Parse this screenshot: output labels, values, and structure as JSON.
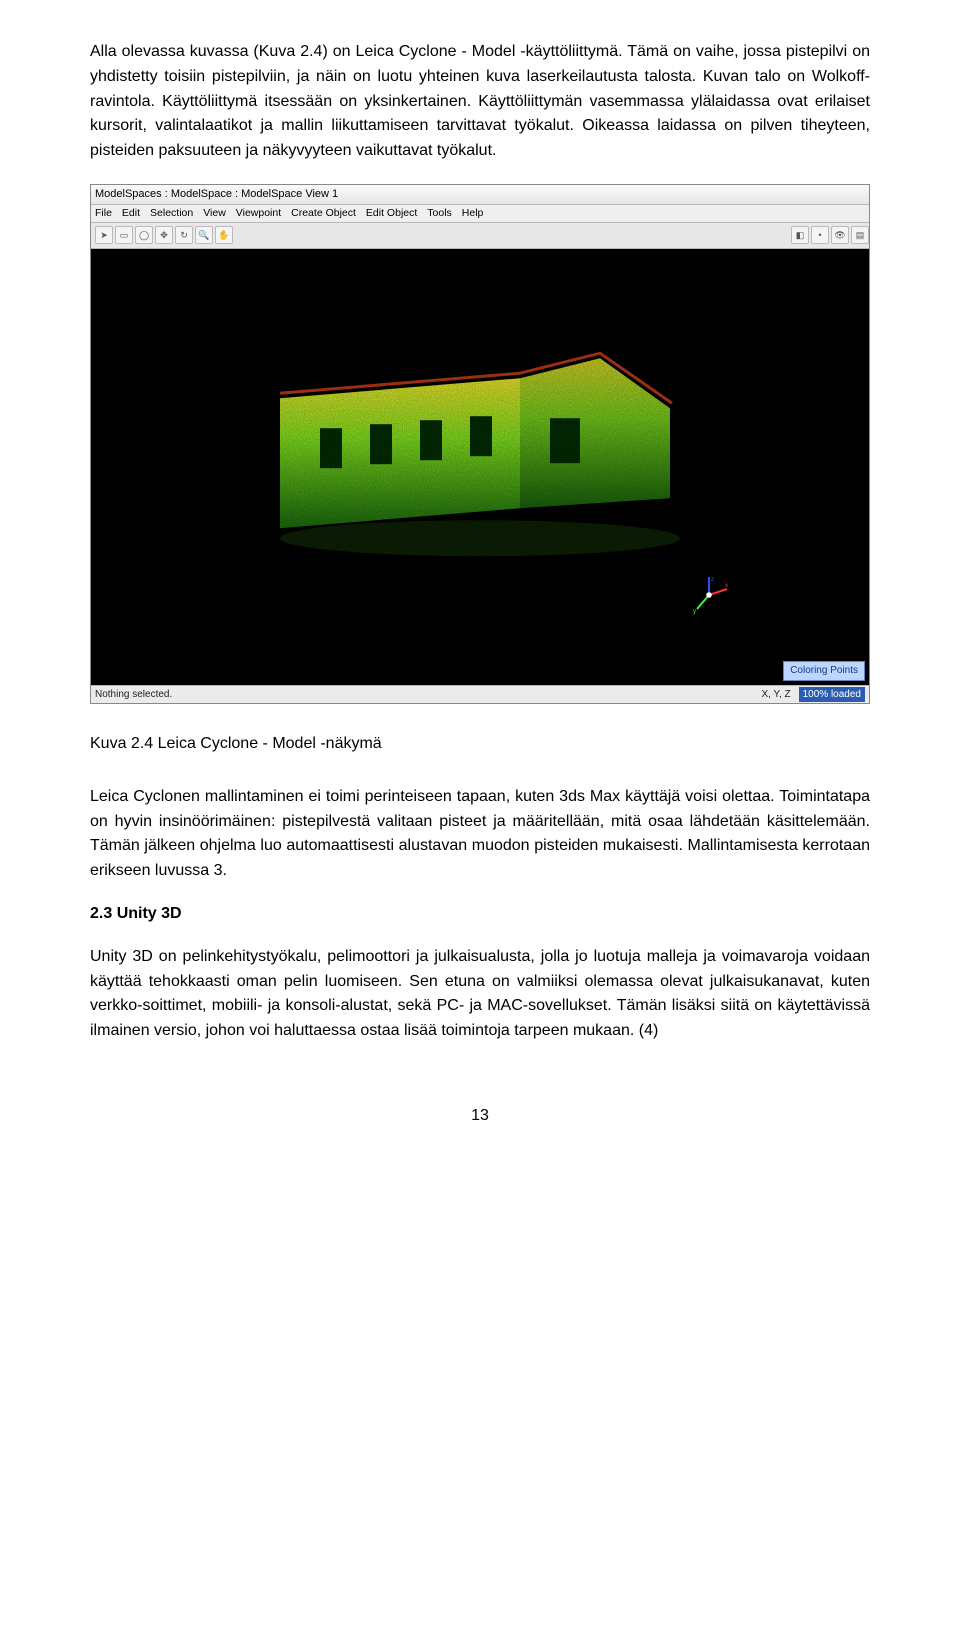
{
  "para1": "Alla olevassa kuvassa (Kuva 2.4) on Leica Cyclone - Model -käyttöliittymä. Tämä on vaihe, jossa pistepilvi on yhdistetty toisiin pistepilviin, ja näin on luotu yhteinen kuva laserkeilautusta talosta. Kuvan talo on Wolkoff-ravintola. Käyttöliittymä itsessään on yksinkertainen. Käyttöliittymän vasemmassa ylälaidassa ovat erilaiset kursorit, valintalaatikot ja mallin liikuttamiseen tarvittavat työkalut. Oikeassa laidassa on pilven tiheyteen, pisteiden paksuuteen ja näkyvyyteen vaikuttavat työkalut.",
  "screenshot": {
    "title": "ModelSpaces : ModelSpace : ModelSpace View 1",
    "menu": [
      "File",
      "Edit",
      "Selection",
      "View",
      "Viewpoint",
      "Create Object",
      "Edit Object",
      "Tools",
      "Help"
    ],
    "viewport_badge": "Coloring Points",
    "status_left": "Nothing selected.",
    "status_coords": "X, Y, Z",
    "status_loaded": "100% loaded"
  },
  "caption": "Kuva 2.4 Leica Cyclone - Model -näkymä",
  "para2": "Leica Cyclonen mallintaminen ei toimi perinteiseen tapaan, kuten 3ds Max käyttäjä voisi olettaa. Toimintatapa on hyvin insinöörimäinen: pistepilvestä valitaan pisteet ja määritellään, mitä osaa lähdetään käsittelemään. Tämän jälkeen ohjelma luo automaattisesti alustavan muodon pisteiden mukaisesti. Mallintamisesta kerrotaan erikseen luvussa 3.",
  "heading": "2.3 Unity 3D",
  "para3": "Unity 3D on pelinkehitystyökalu, pelimoottori ja julkaisualusta, jolla jo luotuja malleja ja voimavaroja voidaan käyttää tehokkaasti oman pelin luomiseen. Sen etuna on valmiiksi olemassa olevat julkaisukanavat, kuten verkko-soittimet, mobiili- ja konsoli-alustat, sekä PC- ja MAC-sovellukset. Tämän lisäksi siitä on käytettävissä ilmainen versio, johon voi haluttaessa ostaa lisää toimintoja tarpeen mukaan. (4)",
  "pagenum": "13"
}
